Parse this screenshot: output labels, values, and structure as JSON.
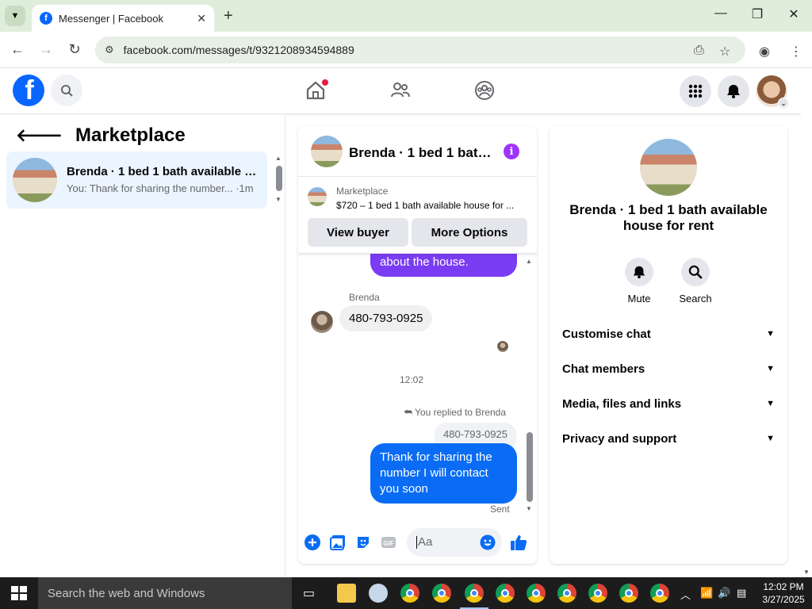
{
  "browser": {
    "tab_title": "Messenger | Facebook",
    "url": "facebook.com/messages/t/9321208934594889"
  },
  "left_panel": {
    "title": "Marketplace",
    "conversation": {
      "name": "Brenda · 1 bed 1 bath available h...",
      "preview": "You: Thank for sharing the number... ·1m"
    }
  },
  "chat": {
    "header_name": "Brenda · 1 bed 1 bath...",
    "marketplace_label": "Marketplace",
    "listing": "$720 – 1 bed 1 bath available house for ...",
    "view_buyer_label": "View buyer",
    "more_options_label": "More Options",
    "messages": {
      "partial_sent": "and the requirements\nabout the house.",
      "sender_name": "Brenda",
      "received": "480-793-0925",
      "timestamp": "12:02",
      "replied_to": "You replied to Brenda",
      "quoted": "480-793-0925",
      "sent": "Thank for sharing  the number I will contact you soon",
      "status": "Sent"
    },
    "composer_placeholder": "Aa"
  },
  "right_panel": {
    "name": "Brenda · 1 bed 1 bath available house for rent",
    "mute_label": "Mute",
    "search_label": "Search",
    "sections": [
      "Customise chat",
      "Chat members",
      "Media, files and links",
      "Privacy and support"
    ]
  },
  "taskbar": {
    "search_placeholder": "Search the web and Windows",
    "time": "12:02 PM",
    "date": "3/27/2025"
  },
  "colors": {
    "facebook_blue": "#0866ff",
    "sent_bubble": "#0a6cf5",
    "purple_bubble": "#7a3cf2",
    "selected_conversation": "#ebf5ff",
    "notification_red": "#e41e3f"
  }
}
